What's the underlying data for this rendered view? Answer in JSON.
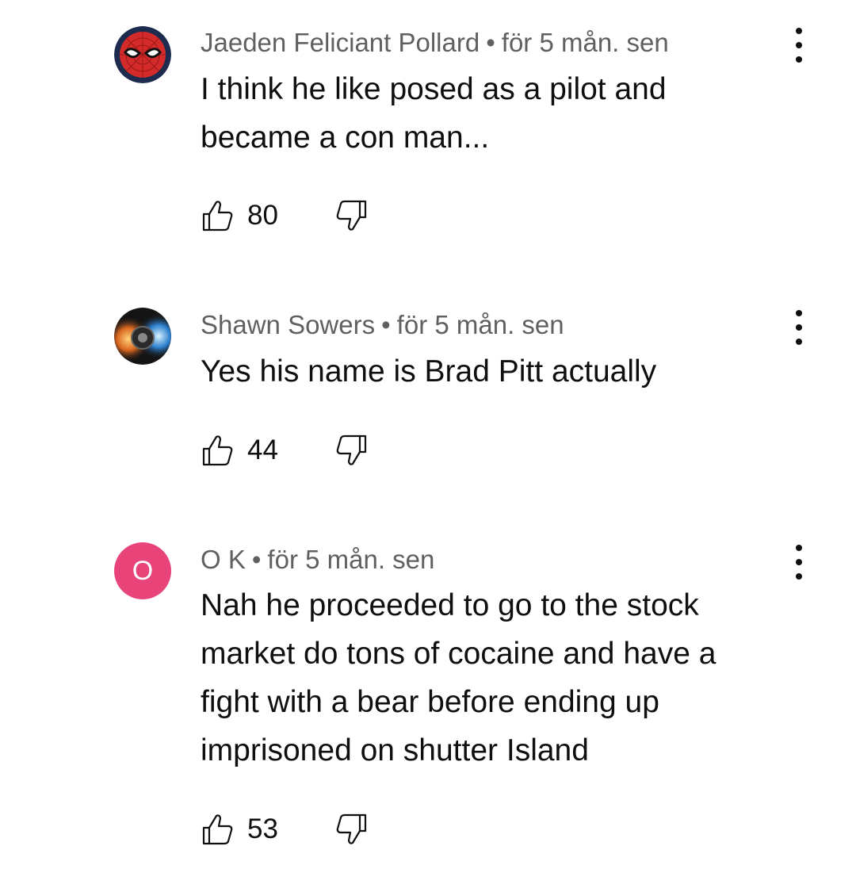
{
  "comments": [
    {
      "author": "Jaeden Feliciant Pollard",
      "time": "för 5 mån. sen",
      "text": "I think he like posed as a pilot and became a con man...",
      "likes": "80",
      "avatar": "spiderman-mask-icon"
    },
    {
      "author": "Shawn Sowers",
      "time": "för 5 mån. sen",
      "text": "Yes his name is Brad Pitt actually",
      "likes": "44",
      "avatar": "cosmic-helmet-image"
    },
    {
      "author": "O K",
      "time": "för 5 mån. sen",
      "text": "Nah he proceeded to go to the stock market do tons of cocaine and have a fight with a bear before ending up imprisoned on shutter Island",
      "likes": "53",
      "avatar_letter": "O",
      "avatar_color": "#e8447a"
    }
  ],
  "separator": "•",
  "icons": {
    "like": "thumbs-up-icon",
    "dislike": "thumbs-down-icon",
    "menu": "more-vertical-icon"
  }
}
